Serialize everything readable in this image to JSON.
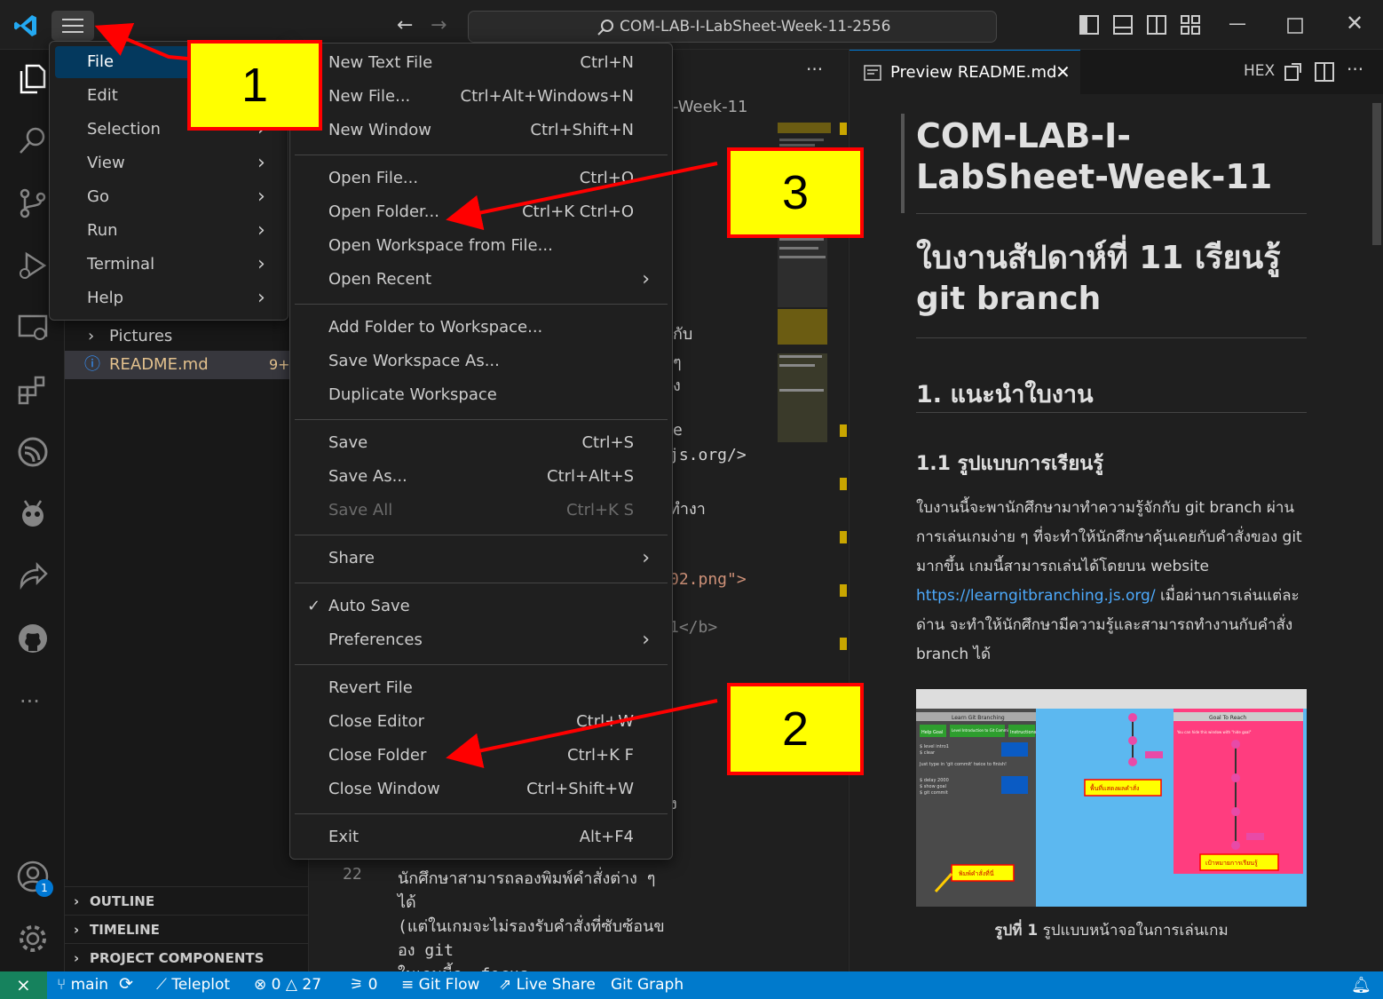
{
  "titlebar": {
    "search_text": "COM-LAB-I-LabSheet-Week-11-2556"
  },
  "activitybar": {
    "account_badge": "1"
  },
  "sidebar": {
    "items": [
      {
        "label": "Pictures",
        "kind": "folder"
      },
      {
        "label": "README.md",
        "kind": "file",
        "badge": "9+"
      }
    ],
    "sections": [
      "OUTLINE",
      "TIMELINE",
      "PROJECT COMPONENTS"
    ]
  },
  "editor": {
    "breadcrumb": "-Week-11",
    "fragments": [
      "กับ",
      "ๆ",
      "ง",
      "e",
      "js.org/>",
      "ทำงา",
      "02.png\">",
      "1</b>",
      "ง"
    ],
    "line22": "22",
    "code_line_1": "นักศึกษาสามารถลองพิมพ์คำสั่งต่าง ๆ",
    "code_line_2": "ได้",
    "code_line_3": "(แต่ในเกมจะไม่รองรับคำสั่งที่ซับซ้อนข",
    "code_line_4": "อง git",
    "code_line_5": "ในเกมนี้จะ focus"
  },
  "preview": {
    "tab_title": "Preview README.md",
    "hex_label": "HEX",
    "h1": "COM-LAB-I-LabSheet-Week-11",
    "h2_thai": "ใบงานสัปดาห์ที่ 11 เรียนรู้ git branch",
    "h_intro": "1. แนะนำใบงาน",
    "h_sub": "1.1 รูปแบบการเรียนรู้",
    "para_before_link": "ใบงานนี้จะพานักศึกษามาทำความรู้จักกับ git branch ผ่านการเล่นเกมง่าย ๆ ที่จะทำให้นักศึกษาคุ้นเคยกับคำสั่งของ git มากขึ้น เกมนี้สามารถเล่นได้โดยบน website ",
    "link": "https://learngitbranching.js.org/",
    "para_after_link": " เมื่อผ่านการเล่นแต่ละด่าน จะทำให้นักศึกษามีความรู้และสามารถทำงานกับคำสั่ง branch ได้",
    "caption_bold": "รูปที่ 1",
    "caption_rest": " รูปแบบหน้าจอในการเล่นเกม",
    "image_labels": {
      "btn1": "Help Goal",
      "btn2": "Level Introduction to Git Commits",
      "btn3": "Instructions",
      "console1": "$ level intro1",
      "console2": "$ ​​​​​​​​clear",
      "console3": "Just type in 'git commit' twice to finish!",
      "console4": "$ delay 2000",
      "console5": "$ show goal",
      "console6": "$ git commit",
      "mid_label": "พื้นที่แสดงผลคำสั่ง",
      "goal_head": "Goal To Reach",
      "goal_text": "You can hide this window with \"hide goal\"",
      "goal_label": "เป้าหมายการเรียนรู้",
      "type_label": "พิมพ์คำสั่งที่นี่",
      "header_left": "Learn Git Branching"
    }
  },
  "menubar": {
    "items": [
      {
        "label": "File",
        "active": true,
        "submenu": false
      },
      {
        "label": "Edit",
        "active": false,
        "submenu": true
      },
      {
        "label": "Selection",
        "active": false,
        "submenu": true
      },
      {
        "label": "View",
        "active": false,
        "submenu": true
      },
      {
        "label": "Go",
        "active": false,
        "submenu": true
      },
      {
        "label": "Run",
        "active": false,
        "submenu": true
      },
      {
        "label": "Terminal",
        "active": false,
        "submenu": true
      },
      {
        "label": "Help",
        "active": false,
        "submenu": true
      }
    ]
  },
  "file_menu": {
    "groups": [
      [
        {
          "label": "New Text File",
          "key": "Ctrl+N"
        },
        {
          "label": "New File...",
          "key": "Ctrl+Alt+Windows+N"
        },
        {
          "label": "New Window",
          "key": "Ctrl+Shift+N"
        }
      ],
      [
        {
          "label": "Open File...",
          "key": "Ctrl+O"
        },
        {
          "label": "Open Folder...",
          "key": "Ctrl+K Ctrl+O"
        },
        {
          "label": "Open Workspace from File...",
          "key": ""
        },
        {
          "label": "Open Recent",
          "key": "",
          "submenu": true
        }
      ],
      [
        {
          "label": "Add Folder to Workspace...",
          "key": ""
        },
        {
          "label": "Save Workspace As...",
          "key": ""
        },
        {
          "label": "Duplicate Workspace",
          "key": ""
        }
      ],
      [
        {
          "label": "Save",
          "key": "Ctrl+S"
        },
        {
          "label": "Save As...",
          "key": "Ctrl+Alt+S"
        },
        {
          "label": "Save All",
          "key": "Ctrl+K S",
          "disabled": true
        }
      ],
      [
        {
          "label": "Share",
          "key": "",
          "submenu": true
        }
      ],
      [
        {
          "label": "Auto Save",
          "key": "",
          "checked": true
        },
        {
          "label": "Preferences",
          "key": "",
          "submenu": true
        }
      ],
      [
        {
          "label": "Revert File",
          "key": ""
        },
        {
          "label": "Close Editor",
          "key": "Ctrl+W"
        },
        {
          "label": "Close Folder",
          "key": "Ctrl+K F"
        },
        {
          "label": "Close Window",
          "key": "Ctrl+Shift+W"
        }
      ],
      [
        {
          "label": "Exit",
          "key": "Alt+F4"
        }
      ]
    ]
  },
  "statusbar": {
    "branch": "main",
    "teleplot": "Teleplot",
    "errors": "0",
    "warnings": "27",
    "ports": "0",
    "gitflow": "Git Flow",
    "liveshare": "Live Share",
    "gitgraph": "Git Graph"
  },
  "annotations": {
    "callout1": "1",
    "callout2": "2",
    "callout3": "3"
  },
  "colors": {
    "accent": "#007acc",
    "callout_fill": "#ffff00",
    "callout_border": "#ff0000",
    "arrow": "#ff0000",
    "menu_highlight": "#04395e"
  }
}
